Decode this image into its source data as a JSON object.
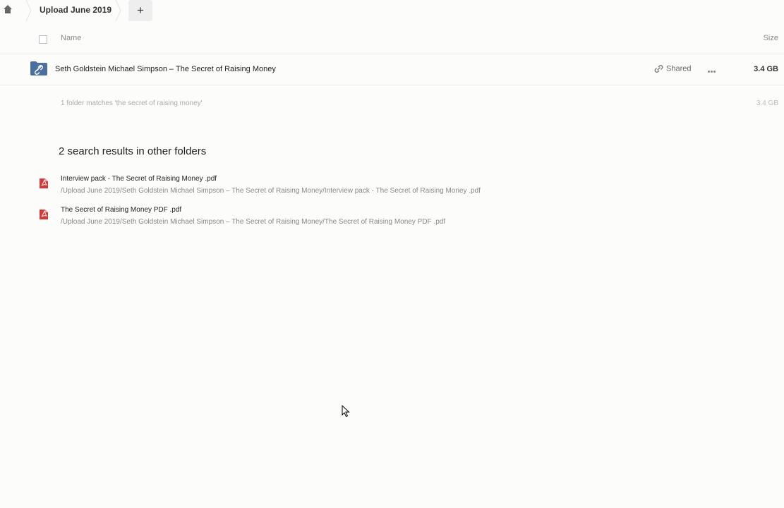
{
  "breadcrumb": {
    "current": "Upload June 2019"
  },
  "toolbar": {
    "add_label": "+"
  },
  "table": {
    "col_name": "Name",
    "col_size": "Size",
    "rows": [
      {
        "name": "Seth Goldstein Michael Simpson – The Secret of Raising Money",
        "shared_label": "Shared",
        "size": "3.4 GB",
        "icon": "shared-folder-icon"
      }
    ],
    "summary": "1 folder matches 'the secret of raising money'",
    "summary_size": "3.4 GB"
  },
  "other_results": {
    "title": "2 search results in other folders",
    "items": [
      {
        "name": "Interview pack - The Secret of Raising Money .pdf",
        "path": "/Upload June 2019/Seth Goldstein Michael Simpson – The Secret of Raising Money/Interview pack - The Secret of Raising Money .pdf",
        "icon": "pdf-icon"
      },
      {
        "name": "The Secret of Raising Money PDF .pdf",
        "path": "/Upload June 2019/Seth Goldstein Michael Simpson – The Secret of Raising Money/The Secret of Raising Money PDF .pdf",
        "icon": "pdf-icon"
      }
    ]
  },
  "colors": {
    "folder_accent": "#4a6fa0",
    "pdf_red": "#d23a3a",
    "background": "#fcfcfb"
  }
}
